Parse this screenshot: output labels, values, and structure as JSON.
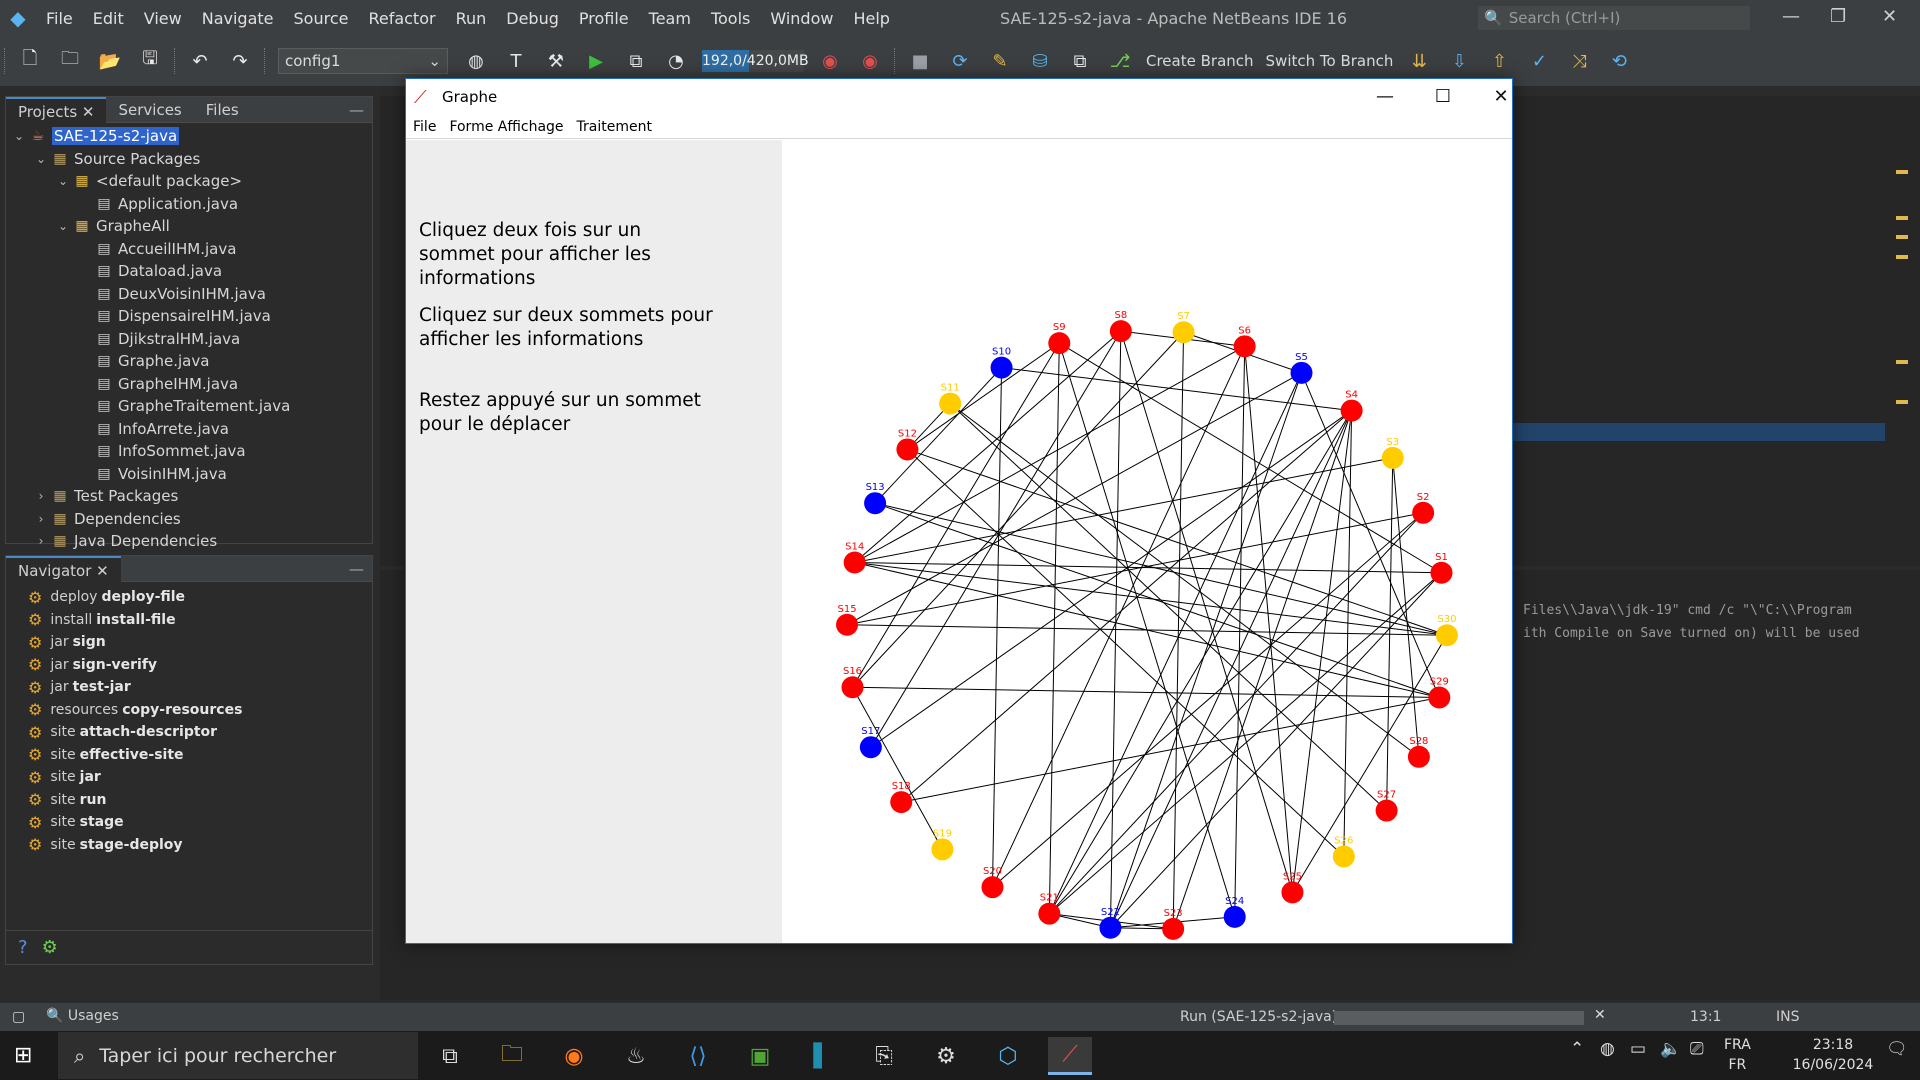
{
  "ide": {
    "title": "SAE-125-s2-java - Apache NetBeans IDE 16",
    "menu": [
      "File",
      "Edit",
      "View",
      "Navigate",
      "Source",
      "Refactor",
      "Run",
      "Debug",
      "Profile",
      "Team",
      "Tools",
      "Window",
      "Help"
    ],
    "search_placeholder": "Search (Ctrl+I)",
    "config": "config1",
    "memory": {
      "text": "192,0/420,0MB",
      "used_fraction": 0.457
    },
    "create_branch": "Create Branch",
    "switch_branch": "Switch To Branch"
  },
  "projects": {
    "tabs": [
      "Projects",
      "Services",
      "Files"
    ],
    "tree": [
      {
        "label": "SAE-125-s2-java",
        "level": 0,
        "icon": "project-icon",
        "expanded": true,
        "selected": true
      },
      {
        "label": "Source Packages",
        "level": 1,
        "icon": "folder-icon",
        "expanded": true
      },
      {
        "label": "<default package>",
        "level": 2,
        "icon": "package-icon",
        "expanded": true
      },
      {
        "label": "Application.java",
        "level": 3,
        "icon": "java-file-icon"
      },
      {
        "label": "GrapheAll",
        "level": 2,
        "icon": "package-icon",
        "expanded": true
      },
      {
        "label": "AccueilIHM.java",
        "level": 3,
        "icon": "java-file-icon"
      },
      {
        "label": "Dataload.java",
        "level": 3,
        "icon": "java-file-icon"
      },
      {
        "label": "DeuxVoisinIHM.java",
        "level": 3,
        "icon": "java-file-icon"
      },
      {
        "label": "DispensaireIHM.java",
        "level": 3,
        "icon": "java-file-icon"
      },
      {
        "label": "DjikstralHM.java",
        "level": 3,
        "icon": "java-file-icon"
      },
      {
        "label": "Graphe.java",
        "level": 3,
        "icon": "java-file-icon"
      },
      {
        "label": "GrapheIHM.java",
        "level": 3,
        "icon": "java-file-icon"
      },
      {
        "label": "GrapheTraitement.java",
        "level": 3,
        "icon": "java-file-icon"
      },
      {
        "label": "InfoArrete.java",
        "level": 3,
        "icon": "java-file-icon"
      },
      {
        "label": "InfoSommet.java",
        "level": 3,
        "icon": "java-file-icon"
      },
      {
        "label": "VoisinIHM.java",
        "level": 3,
        "icon": "java-file-icon"
      },
      {
        "label": "Test Packages",
        "level": 1,
        "icon": "folder-icon",
        "expanded": false
      },
      {
        "label": "Dependencies",
        "level": 1,
        "icon": "folder-icon",
        "expanded": false
      },
      {
        "label": "Java Dependencies",
        "level": 1,
        "icon": "folder-icon",
        "expanded": false
      }
    ]
  },
  "navigator": {
    "title": "Navigator",
    "items": [
      {
        "prefix": "deploy",
        "goal": "deploy-file"
      },
      {
        "prefix": "install",
        "goal": "install-file"
      },
      {
        "prefix": "jar",
        "goal": "sign"
      },
      {
        "prefix": "jar",
        "goal": "sign-verify"
      },
      {
        "prefix": "jar",
        "goal": "test-jar"
      },
      {
        "prefix": "resources",
        "goal": "copy-resources"
      },
      {
        "prefix": "site",
        "goal": "attach-descriptor"
      },
      {
        "prefix": "site",
        "goal": "effective-site"
      },
      {
        "prefix": "site",
        "goal": "jar"
      },
      {
        "prefix": "site",
        "goal": "run"
      },
      {
        "prefix": "site",
        "goal": "stage"
      },
      {
        "prefix": "site",
        "goal": "stage-deploy"
      }
    ]
  },
  "output": {
    "line1": "Files\\\\Java\\\\jdk-19\" cmd /c \"\\\"C:\\\\Program",
    "line2": "ith Compile on Save turned on) will be used"
  },
  "status": {
    "usages": "Usages",
    "run": "Run (SAE-125-s2-java)",
    "caret": "13:1",
    "mode": "INS"
  },
  "graphe": {
    "title": "Graphe",
    "menu": [
      "File",
      "Forme Affichage",
      "Traitement"
    ],
    "instructions": [
      "Cliquez deux fois sur un sommet pour afficher les informations",
      "Cliquez sur deux sommets pour afficher les informations",
      "Restez appuyé sur un sommet pour le déplacer"
    ],
    "colors": {
      "red": "#ff0000",
      "blue": "#0000ff",
      "yellow": "#ffcc00"
    },
    "vertices": [
      {
        "id": "S1",
        "color": "red"
      },
      {
        "id": "S2",
        "color": "red"
      },
      {
        "id": "S3",
        "color": "yellow"
      },
      {
        "id": "S4",
        "color": "red"
      },
      {
        "id": "S5",
        "color": "blue"
      },
      {
        "id": "S6",
        "color": "red"
      },
      {
        "id": "S7",
        "color": "yellow"
      },
      {
        "id": "S8",
        "color": "red"
      },
      {
        "id": "S9",
        "color": "red"
      },
      {
        "id": "S10",
        "color": "blue"
      },
      {
        "id": "S11",
        "color": "yellow"
      },
      {
        "id": "S12",
        "color": "red"
      },
      {
        "id": "S13",
        "color": "blue"
      },
      {
        "id": "S14",
        "color": "red"
      },
      {
        "id": "S15",
        "color": "red"
      },
      {
        "id": "S16",
        "color": "red"
      },
      {
        "id": "S17",
        "color": "blue"
      },
      {
        "id": "S18",
        "color": "red"
      },
      {
        "id": "S19",
        "color": "yellow"
      },
      {
        "id": "S20",
        "color": "red"
      },
      {
        "id": "S21",
        "color": "red"
      },
      {
        "id": "S22",
        "color": "blue"
      },
      {
        "id": "S23",
        "color": "red"
      },
      {
        "id": "S24",
        "color": "blue"
      },
      {
        "id": "S25",
        "color": "red"
      },
      {
        "id": "S26",
        "color": "yellow"
      },
      {
        "id": "S27",
        "color": "red"
      },
      {
        "id": "S28",
        "color": "red"
      },
      {
        "id": "S29",
        "color": "red"
      },
      {
        "id": "S30",
        "color": "yellow"
      }
    ],
    "edges": [
      [
        "S9",
        "S21"
      ],
      [
        "S9",
        "S12"
      ],
      [
        "S9",
        "S24"
      ],
      [
        "S9",
        "S1"
      ],
      [
        "S8",
        "S22"
      ],
      [
        "S8",
        "S25"
      ],
      [
        "S8",
        "S14"
      ],
      [
        "S8",
        "S6"
      ],
      [
        "S7",
        "S23"
      ],
      [
        "S7",
        "S5"
      ],
      [
        "S7",
        "S16"
      ],
      [
        "S6",
        "S14"
      ],
      [
        "S6",
        "S20"
      ],
      [
        "S6",
        "S25"
      ],
      [
        "S5",
        "S15"
      ],
      [
        "S5",
        "S21"
      ],
      [
        "S5",
        "S22"
      ],
      [
        "S5",
        "S29"
      ],
      [
        "S4",
        "S21"
      ],
      [
        "S4",
        "S18"
      ],
      [
        "S4",
        "S22"
      ],
      [
        "S4",
        "S23"
      ],
      [
        "S4",
        "S25"
      ],
      [
        "S4",
        "S17"
      ],
      [
        "S3",
        "S27"
      ],
      [
        "S3",
        "S14"
      ],
      [
        "S10",
        "S20"
      ],
      [
        "S10",
        "S13"
      ],
      [
        "S10",
        "S4"
      ],
      [
        "S11",
        "S27"
      ],
      [
        "S11",
        "S12"
      ],
      [
        "S12",
        "S30"
      ],
      [
        "S12",
        "S26"
      ],
      [
        "S13",
        "S29"
      ],
      [
        "S13",
        "S30"
      ],
      [
        "S14",
        "S1"
      ],
      [
        "S14",
        "S29"
      ],
      [
        "S14",
        "S30"
      ],
      [
        "S15",
        "S30"
      ],
      [
        "S16",
        "S29"
      ],
      [
        "S16",
        "S19"
      ],
      [
        "S16",
        "S9"
      ],
      [
        "S17",
        "S8"
      ],
      [
        "S18",
        "S29"
      ],
      [
        "S21",
        "S22"
      ],
      [
        "S21",
        "S23"
      ],
      [
        "S21",
        "S2"
      ],
      [
        "S21",
        "S1"
      ],
      [
        "S22",
        "S23"
      ],
      [
        "S22",
        "S24"
      ],
      [
        "S22",
        "S1"
      ],
      [
        "S24",
        "S6"
      ],
      [
        "S25",
        "S30"
      ],
      [
        "S2",
        "S15"
      ],
      [
        "S2",
        "S20"
      ],
      [
        "S28",
        "S3"
      ],
      [
        "S28",
        "S11"
      ],
      [
        "S26",
        "S4"
      ]
    ]
  },
  "taskbar": {
    "search_placeholder": "Taper ici pour rechercher",
    "lang_top": "FRA",
    "lang_bottom": "FR",
    "time": "23:18",
    "date": "16/06/2024"
  }
}
